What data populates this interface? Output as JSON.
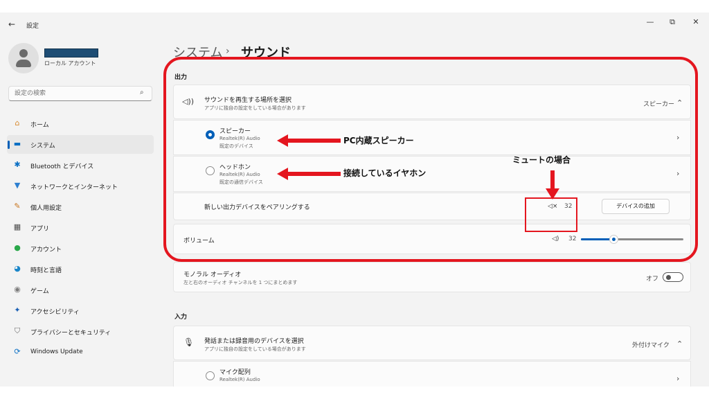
{
  "window": {
    "title": "設定",
    "back_glyph": "←",
    "minimize": "—",
    "restore": "⧉",
    "close": "✕"
  },
  "profile": {
    "account_type": "ローカル アカウント"
  },
  "search": {
    "placeholder": "設定の検索",
    "icon": "search-icon"
  },
  "nav": [
    {
      "label": "ホーム",
      "icon": "home-icon",
      "glyph": "⌂",
      "color": "#d88a2e"
    },
    {
      "label": "システム",
      "icon": "monitor-icon",
      "glyph": "▬",
      "color": "#0a6fc4",
      "active": true
    },
    {
      "label": "Bluetooth とデバイス",
      "icon": "bluetooth-icon",
      "glyph": "✱",
      "color": "#0a6fc4"
    },
    {
      "label": "ネットワークとインターネット",
      "icon": "wifi-icon",
      "glyph": "▼",
      "color": "#2d7fd0"
    },
    {
      "label": "個人用設定",
      "icon": "brush-icon",
      "glyph": "✎",
      "color": "#c8741d"
    },
    {
      "label": "アプリ",
      "icon": "apps-icon",
      "glyph": "▦",
      "color": "#4d4d4d"
    },
    {
      "label": "アカウント",
      "icon": "person-icon",
      "glyph": "●",
      "color": "#2aa84a"
    },
    {
      "label": "時刻と言語",
      "icon": "globe-clock-icon",
      "glyph": "◕",
      "color": "#1a86c9"
    },
    {
      "label": "ゲーム",
      "icon": "gamepad-icon",
      "glyph": "◉",
      "color": "#7a7a7a"
    },
    {
      "label": "アクセシビリティ",
      "icon": "accessibility-icon",
      "glyph": "✦",
      "color": "#1a5fb4"
    },
    {
      "label": "プライバシーとセキュリティ",
      "icon": "shield-icon",
      "glyph": "⛉",
      "color": "#6a6a6a"
    },
    {
      "label": "Windows Update",
      "icon": "update-icon",
      "glyph": "⟳",
      "color": "#0a6fc4"
    }
  ],
  "breadcrumb": {
    "parent": "システム",
    "separator": "›",
    "current": "サウンド"
  },
  "output": {
    "section_label": "出力",
    "chooser": {
      "title": "サウンドを再生する場所を選択",
      "subtitle": "アプリに独自の設定をしている場合があります",
      "selected": "スピーカー",
      "chevron": "⌃"
    },
    "devices": [
      {
        "name": "スピーカー",
        "driver": "Realtek(R) Audio",
        "role": "既定のデバイス",
        "selected": true
      },
      {
        "name": "ヘッドホン",
        "driver": "Realtek(R) Audio",
        "role": "既定の通信デバイス",
        "selected": false
      }
    ],
    "pair": {
      "label": "新しい出力デバイスをペアリングする",
      "button": "デバイスの追加"
    },
    "mute_display": {
      "glyph": "🔇︎",
      "text": "◁×",
      "value": "32"
    },
    "volume": {
      "label": "ボリューム",
      "glyph": "◁)",
      "value": "32",
      "level": 0.32
    }
  },
  "mono": {
    "title": "モノラル オーディオ",
    "subtitle": "左と右のオーディオ チャンネルを 1 つにまとめます",
    "state": "オフ"
  },
  "input": {
    "section_label": "入力",
    "chooser": {
      "title": "発話または録音用のデバイスを選択",
      "subtitle": "アプリに独自の設定をしている場合があります",
      "selected": "外付けマイク",
      "chevron": "⌃"
    },
    "devices": [
      {
        "name": "マイク配列",
        "driver": "Realtek(R) Audio"
      }
    ]
  },
  "annotations": {
    "speaker": "PC内蔵スピーカー",
    "headphone": "接続しているイヤホン",
    "mute": "ミュートの場合",
    "color": "#e4161f"
  }
}
